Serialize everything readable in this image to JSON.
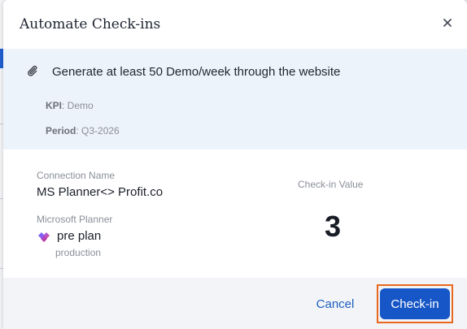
{
  "modal": {
    "title": "Automate Check-ins",
    "close_icon": "close-icon",
    "goal": {
      "icon": "paperclip-icon",
      "text": "Generate at least 50 Demo/week through the website",
      "kpi_label": "KPI",
      "kpi_value": ": Demo",
      "period_label": "Period",
      "period_value": ": Q3-2026"
    },
    "connection": {
      "name_label": "Connection Name",
      "name_value": "MS Planner<> Profit.co",
      "source_label": "Microsoft Planner",
      "source_icon": "microsoft-planner-icon",
      "plan_name": "pre plan",
      "plan_sub": "production"
    },
    "checkin": {
      "label": "Check-in Value",
      "value": "3"
    },
    "footer": {
      "cancel_label": "Cancel",
      "checkin_label": "Check-in"
    }
  },
  "colors": {
    "primary": "#1656c6",
    "panel_bg": "#edf3fb",
    "footer_bg": "#f2f4f7",
    "highlight": "#e8681f"
  }
}
